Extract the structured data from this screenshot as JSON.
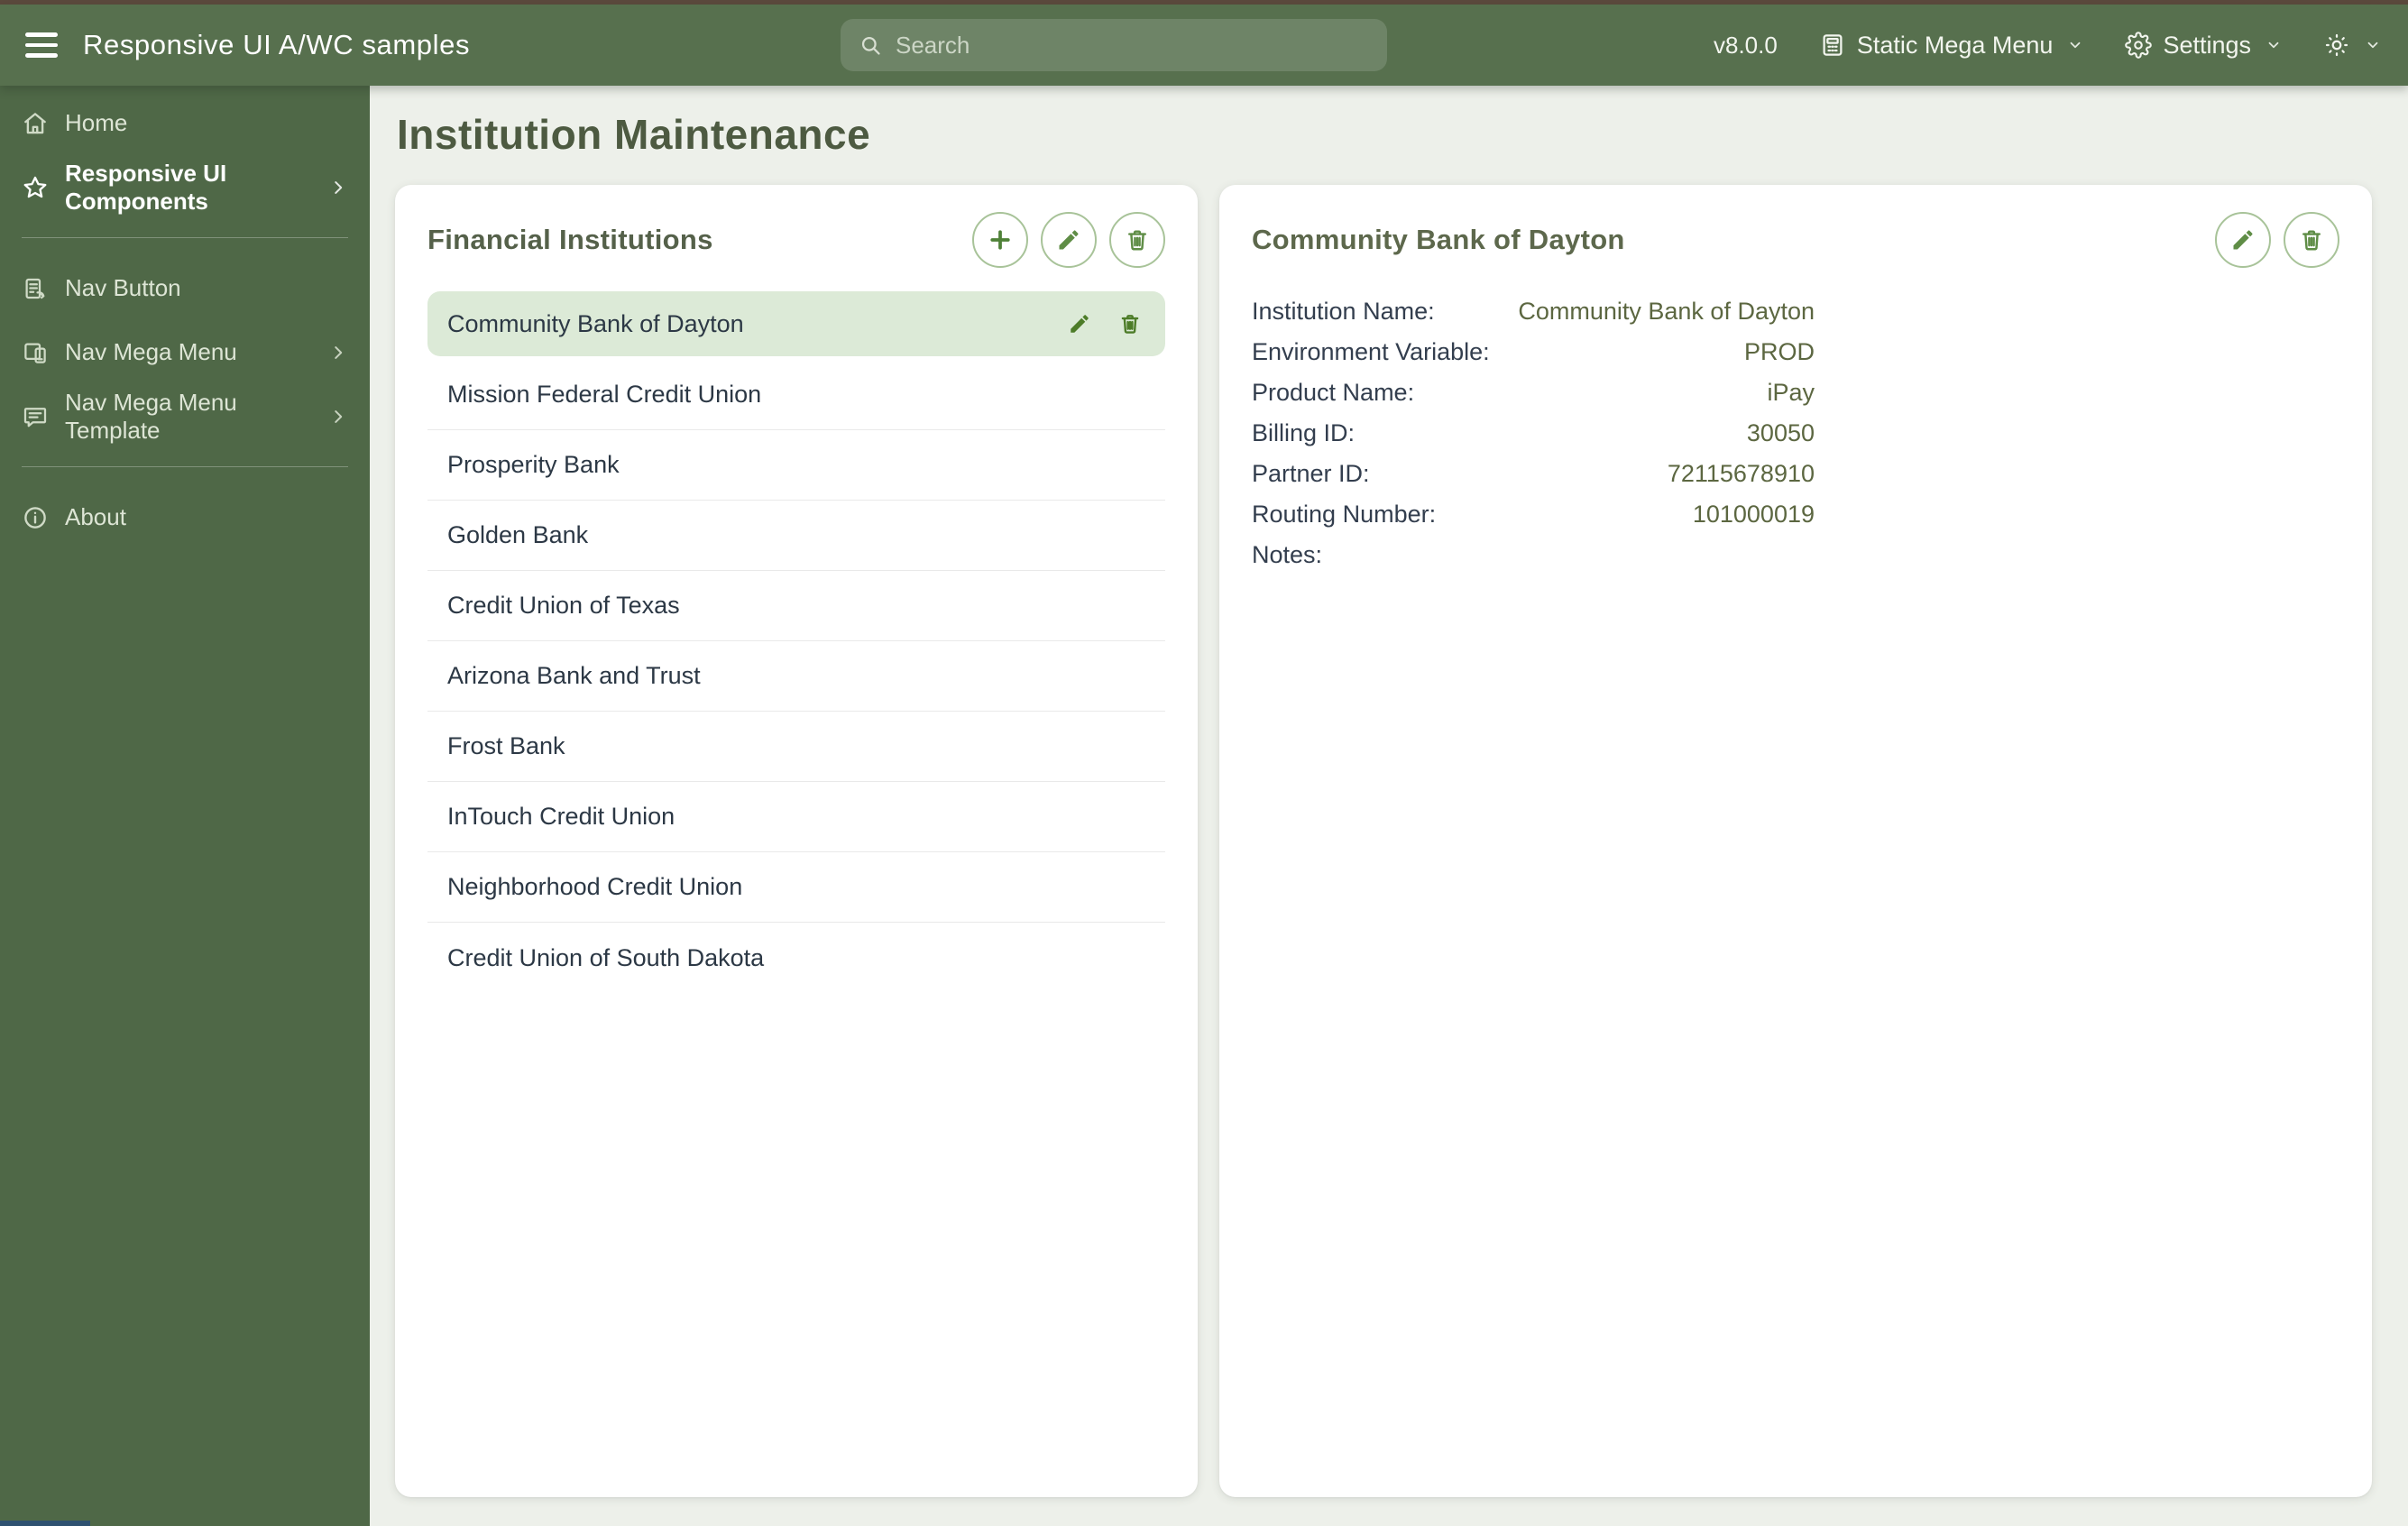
{
  "header": {
    "app_title": "Responsive UI A/WC samples",
    "search_placeholder": "Search",
    "version": "v8.0.0",
    "mega_menu_label": "Static Mega Menu",
    "settings_label": "Settings"
  },
  "sidebar": {
    "groups": [
      {
        "items": [
          {
            "label": "Home",
            "icon": "home",
            "active": false,
            "chevron": false
          },
          {
            "label": "Responsive UI Components",
            "icon": "star",
            "active": true,
            "chevron": true
          }
        ]
      },
      {
        "items": [
          {
            "label": "Nav Button",
            "icon": "form",
            "active": false,
            "chevron": false
          },
          {
            "label": "Nav Mega Menu",
            "icon": "devices",
            "active": false,
            "chevron": true
          },
          {
            "label": "Nav Mega Menu Template",
            "icon": "chat",
            "active": false,
            "chevron": true
          }
        ]
      },
      {
        "items": [
          {
            "label": "About",
            "icon": "info",
            "active": false,
            "chevron": false
          }
        ]
      }
    ]
  },
  "main": {
    "page_title": "Institution Maintenance",
    "list_panel": {
      "title": "Financial Institutions",
      "selected_index": 0,
      "items": [
        "Community Bank of Dayton",
        "Mission Federal Credit Union",
        "Prosperity Bank",
        "Golden Bank",
        "Credit Union of Texas",
        "Arizona Bank and Trust",
        "Frost Bank",
        "InTouch Credit Union",
        "Neighborhood Credit Union",
        "Credit Union of South Dakota"
      ]
    },
    "detail_panel": {
      "title": "Community Bank of Dayton",
      "fields": [
        {
          "label": "Institution Name:",
          "value": "Community Bank of Dayton"
        },
        {
          "label": "Environment Variable:",
          "value": "PROD"
        },
        {
          "label": "Product Name:",
          "value": "iPay"
        },
        {
          "label": "Billing ID:",
          "value": "30050"
        },
        {
          "label": "Partner ID:",
          "value": "72115678910"
        },
        {
          "label": "Routing Number:",
          "value": "101000019"
        },
        {
          "label": "Notes:",
          "value": ""
        }
      ]
    }
  },
  "colors": {
    "top_strip": "#5c4a3d",
    "header_bg": "#57704e",
    "sidebar_bg": "#4f6847",
    "content_bg": "#edf0ea",
    "accent_green": "#5f8d46",
    "accent_green_dark": "#4d7c28",
    "selected_row_bg": "#dcead7",
    "page_title_text": "#4d5a41",
    "panel_title_text": "#55614a",
    "detail_value_text": "#5c6741",
    "body_text": "#2c3845",
    "corner_strip": "#2e5170"
  }
}
